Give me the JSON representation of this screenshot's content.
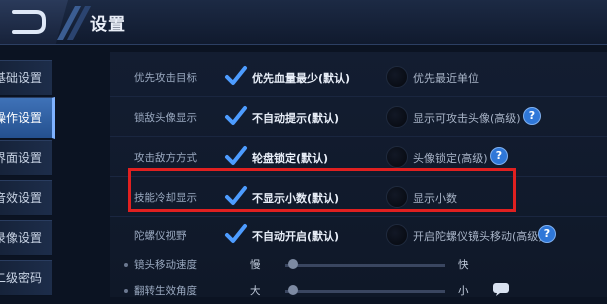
{
  "header": {
    "title": "设置"
  },
  "sidebar": {
    "items": [
      {
        "label": "基础设置"
      },
      {
        "label": "操作设置"
      },
      {
        "label": "界面设置"
      },
      {
        "label": "音效设置"
      },
      {
        "label": "录像设置"
      },
      {
        "label": "二级密码"
      }
    ],
    "active_index": 1
  },
  "settings": {
    "rows": [
      {
        "label": "优先攻击目标",
        "option1": "优先血量最少(默认)",
        "option1_checked": true,
        "option2": "优先最近单位",
        "option2_checked": false,
        "help": false
      },
      {
        "label": "锁敌头像显示",
        "option1": "不自动提示(默认)",
        "option1_checked": true,
        "option2": "显示可攻击头像(高级)",
        "option2_checked": false,
        "help": true
      },
      {
        "label": "攻击敌方方式",
        "option1": "轮盘锁定(默认)",
        "option1_checked": true,
        "option2": "头像锁定(高级)",
        "option2_checked": false,
        "help": true
      },
      {
        "label": "技能冷却显示",
        "option1": "不显示小数(默认)",
        "option1_checked": true,
        "option2": "显示小数",
        "option2_checked": false,
        "help": false
      },
      {
        "label": "陀螺仪视野",
        "option1": "不自动开启(默认)",
        "option1_checked": true,
        "option2": "开启陀螺仪镜头移动(高级)",
        "option2_checked": false,
        "help": true
      }
    ],
    "sliders": [
      {
        "label": "镜头移动速度",
        "left": "慢",
        "right": "快",
        "value": 0.05
      },
      {
        "label": "翻转生效角度",
        "left": "大",
        "right": "小",
        "value": 0.05
      }
    ]
  },
  "help_icon_text": "?",
  "colors": {
    "highlight": "#e02020",
    "check": "#4d9cff",
    "active_tab": "#3f72b8"
  }
}
